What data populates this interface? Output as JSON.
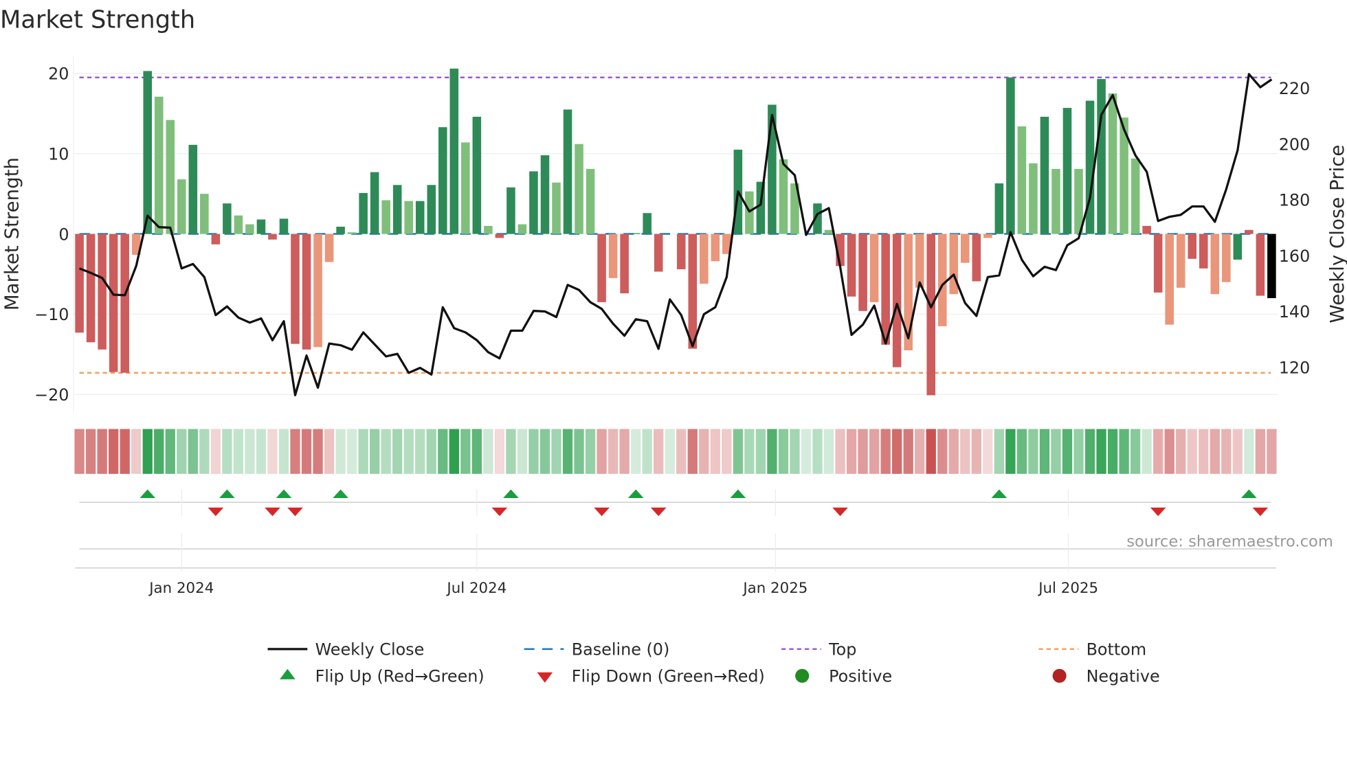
{
  "chart_data": {
    "type": "bar",
    "title": "Market Strength",
    "ylabel": "Market Strength",
    "y2label": "Weekly Close Price",
    "ylim": [
      -23,
      20.5
    ],
    "y2lim": [
      108,
      228
    ],
    "yticks": [
      20,
      10,
      0,
      -10,
      -20
    ],
    "ytick_labels": [
      "20",
      "10",
      "0",
      "−10",
      "−20"
    ],
    "y2ticks": [
      220,
      200,
      180,
      160,
      140,
      120
    ],
    "xticks": [
      {
        "pos": 9,
        "label": "Jan 2024"
      },
      {
        "pos": 35,
        "label": "Jul 2024"
      },
      {
        "pos": 61.3,
        "label": "Jan 2025"
      },
      {
        "pos": 87.1,
        "label": "Jul 2025"
      }
    ],
    "top": 19.5,
    "bottom": -17.3,
    "baseline": 0,
    "strength": [
      -12.3,
      -13.5,
      -14.4,
      -17.2,
      -17.3,
      -2.6,
      20.3,
      17.1,
      14.2,
      6.8,
      11.1,
      5.0,
      -1.3,
      3.8,
      2.3,
      1.2,
      1.8,
      -0.7,
      1.9,
      -13.7,
      -14.4,
      -14.1,
      -3.5,
      0.9,
      0.2,
      5.1,
      7.7,
      4.2,
      6.1,
      4.1,
      4.1,
      6.1,
      13.3,
      20.6,
      11.4,
      14.6,
      1.0,
      -0.5,
      5.8,
      1.2,
      7.8,
      9.8,
      6.4,
      15.5,
      11.2,
      8.1,
      -8.5,
      -5.5,
      -7.4,
      0.1,
      2.6,
      -4.7,
      0,
      -4.4,
      -14.3,
      -6.2,
      -3.4,
      -2.5,
      10.5,
      5.3,
      6.5,
      16.1,
      9.3,
      6.3,
      0,
      3.8,
      0.5,
      -4.0,
      -7.8,
      -9.6,
      -8.5,
      -13.8,
      -16.6,
      -14.5,
      -6.7,
      -20.1,
      -11.5,
      -7.5,
      -3.6,
      -5.9,
      -0.5,
      6.3,
      19.5,
      13.4,
      8.8,
      14.6,
      8.1,
      15.7,
      8.1,
      16.6,
      19.3,
      17.5,
      14.5,
      9.4,
      1.0,
      -7.3,
      -11.3,
      -6.7,
      -3.1,
      -4.3,
      -7.5,
      -6.0,
      -3.2,
      0.5,
      -7.7,
      -8.0
    ],
    "shade": "RRRRRrGgggGgRGggGRGRRrrGgGGgGgGGGGgGgRGgGGgGggRrRGGRRRRrrrGgGGggGGgRRRrRRrrRrrrRrGGggGgGgGGgggRRrrRRrrGRR",
    "weekly_close": [
      155.4,
      153.8,
      152,
      146,
      145.8,
      156.3,
      174.3,
      170.2,
      170,
      155.4,
      157,
      152.3,
      138.7,
      141.8,
      137.8,
      136,
      137.5,
      129.7,
      136.5,
      110,
      124.2,
      112.7,
      128.5,
      127.9,
      126.3,
      132.5,
      128.2,
      123.9,
      124.8,
      118,
      119.8,
      117.4,
      141.5,
      134,
      132.5,
      129.7,
      125.4,
      123.2,
      133.1,
      133.1,
      140.2,
      140,
      138,
      149.5,
      147.7,
      143.3,
      140.9,
      135.6,
      131.3,
      137.2,
      136.5,
      126.6,
      144.3,
      138.7,
      127.6,
      139,
      141.5,
      152.3,
      183,
      175.8,
      178.3,
      210.4,
      192.8,
      188.8,
      167.4,
      174.9,
      177,
      156,
      131.6,
      135.3,
      142.1,
      128.5,
      142.7,
      130.4,
      150.4,
      141.5,
      149.5,
      153.2,
      143,
      138.4,
      152.3,
      152.9,
      168.4,
      158.5,
      152.6,
      156,
      154.8,
      163.7,
      166.2,
      180.7,
      210.4,
      217.5,
      205.2,
      195.9,
      190,
      172.4,
      173.9,
      174.6,
      177.6,
      177.6,
      172.1,
      183.8,
      197.7,
      225,
      220.3,
      223.1
    ],
    "flip_up": [
      6,
      13,
      18,
      23,
      38,
      49,
      58,
      81,
      103
    ],
    "flip_down": [
      12,
      17,
      19,
      37,
      46,
      51,
      67,
      95,
      104
    ],
    "legend": [
      "Weekly Close",
      "Baseline (0)",
      "Top",
      "Bottom",
      "Flip Up (Red→Green)",
      "Flip Down (Green→Red)",
      "Positive",
      "Negative"
    ],
    "legend_placement": "bottom",
    "colors": {
      "strong_pos": "#2e8b57",
      "weak_pos": "#7fbf7b",
      "strong_neg": "#cd5c5c",
      "weak_neg": "#e9967a",
      "top": "#9b59d0",
      "bottom": "#f0a060",
      "baseline": "#1f77b4",
      "flip_up": "#1a9e3f",
      "flip_down": "#d62728",
      "positive": "#228b22",
      "negative": "#b22222",
      "line": "#111111"
    }
  },
  "source": "source: sharemaestro.com"
}
